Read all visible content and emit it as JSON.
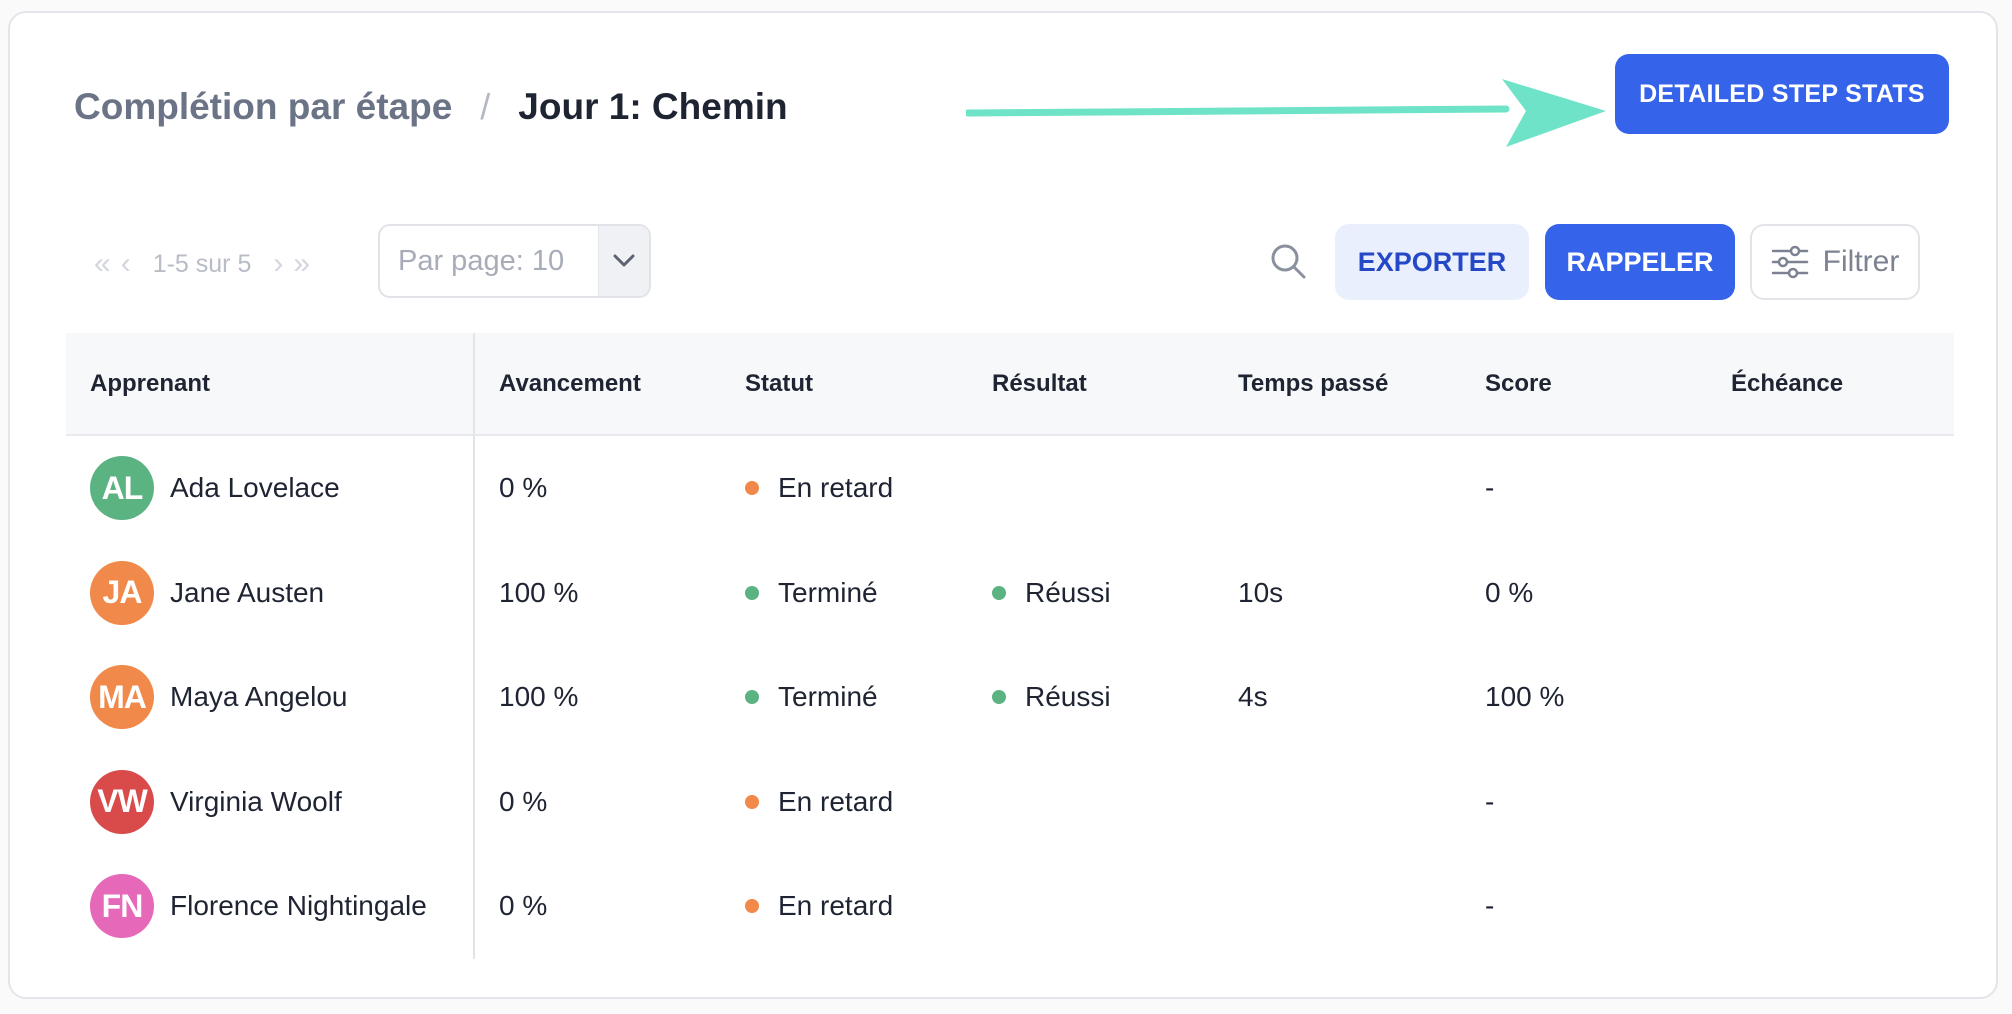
{
  "header": {
    "breadcrumb_parent": "Complétion par étape",
    "breadcrumb_separator": "/",
    "breadcrumb_current": "Jour 1: Chemin",
    "detailed_button": "DETAILED STEP STATS"
  },
  "toolbar": {
    "pagination_text": "1-5 sur 5",
    "per_page_value": "Par page: 10",
    "export_label": "EXPORTER",
    "remind_label": "RAPPELER",
    "filter_label": "Filtrer"
  },
  "colors": {
    "primary": "#3563e9",
    "arrow": "#6fe3c7",
    "status_late": "#f0894a",
    "status_done": "#5cb382"
  },
  "table": {
    "columns": [
      "Apprenant",
      "Avancement",
      "Statut",
      "Résultat",
      "Temps passé",
      "Score",
      "Échéance"
    ],
    "rows": [
      {
        "initials": "AL",
        "avatar_color": "#5cb382",
        "name": "Ada Lovelace",
        "progress": "0 %",
        "status": "En retard",
        "status_color": "#f0894a",
        "result": "",
        "result_color": "",
        "time": "",
        "score": "-",
        "due": ""
      },
      {
        "initials": "JA",
        "avatar_color": "#f0894a",
        "name": "Jane Austen",
        "progress": "100 %",
        "status": "Terminé",
        "status_color": "#5cb382",
        "result": "Réussi",
        "result_color": "#5cb382",
        "time": "10s",
        "score": "0 %",
        "due": ""
      },
      {
        "initials": "MA",
        "avatar_color": "#f0894a",
        "name": "Maya Angelou",
        "progress": "100 %",
        "status": "Terminé",
        "status_color": "#5cb382",
        "result": "Réussi",
        "result_color": "#5cb382",
        "time": "4s",
        "score": "100 %",
        "due": ""
      },
      {
        "initials": "VW",
        "avatar_color": "#d94b4b",
        "name": "Virginia Woolf",
        "progress": "0 %",
        "status": "En retard",
        "status_color": "#f0894a",
        "result": "",
        "result_color": "",
        "time": "",
        "score": "-",
        "due": ""
      },
      {
        "initials": "FN",
        "avatar_color": "#e668b8",
        "name": "Florence Nightingale",
        "progress": "0 %",
        "status": "En retard",
        "status_color": "#f0894a",
        "result": "",
        "result_color": "",
        "time": "",
        "score": "-",
        "due": ""
      }
    ]
  }
}
